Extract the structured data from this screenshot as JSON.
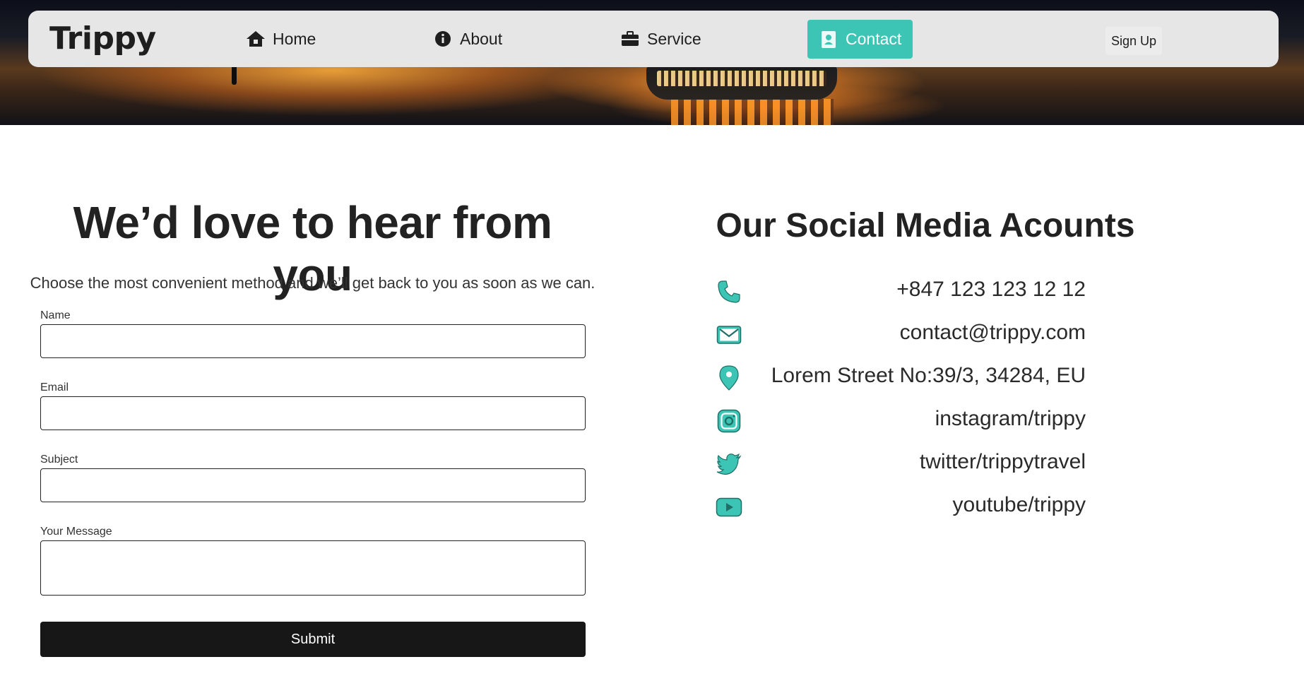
{
  "nav": {
    "brand": "Trippy",
    "links": [
      {
        "label": "Home",
        "icon": "home-icon"
      },
      {
        "label": "About",
        "icon": "info-icon"
      },
      {
        "label": "Service",
        "icon": "briefcase-icon"
      },
      {
        "label": "Contact",
        "icon": "contact-card-icon",
        "active": true
      }
    ],
    "signup_label": "Sign Up"
  },
  "form": {
    "title": "We’d love to hear from you",
    "subtitle": "Choose the most convenient method and we’ll get back to you as soon as we can.",
    "fields": [
      {
        "label": "Name",
        "value": ""
      },
      {
        "label": "Email",
        "value": ""
      },
      {
        "label": "Subject",
        "value": ""
      },
      {
        "label": "Your Message",
        "value": ""
      }
    ],
    "submit_label": "Submit"
  },
  "social": {
    "title": "Our Social Media Acounts",
    "items": [
      {
        "icon": "phone-icon",
        "text": "+847 123 123 12 12"
      },
      {
        "icon": "envelope-icon",
        "text": "contact@trippy.com"
      },
      {
        "icon": "map-pin-icon",
        "text": "Lorem Street No:39/3, 34284, EU"
      },
      {
        "icon": "instagram-icon",
        "text": "instagram/trippy"
      },
      {
        "icon": "twitter-icon",
        "text": "twitter/trippytravel"
      },
      {
        "icon": "youtube-icon",
        "text": "youtube/trippy"
      }
    ]
  },
  "colors": {
    "accent": "#3cc5b5",
    "navbar_bg": "#e6e6e6",
    "submit_bg": "#171717",
    "text": "#1e1e1e"
  }
}
